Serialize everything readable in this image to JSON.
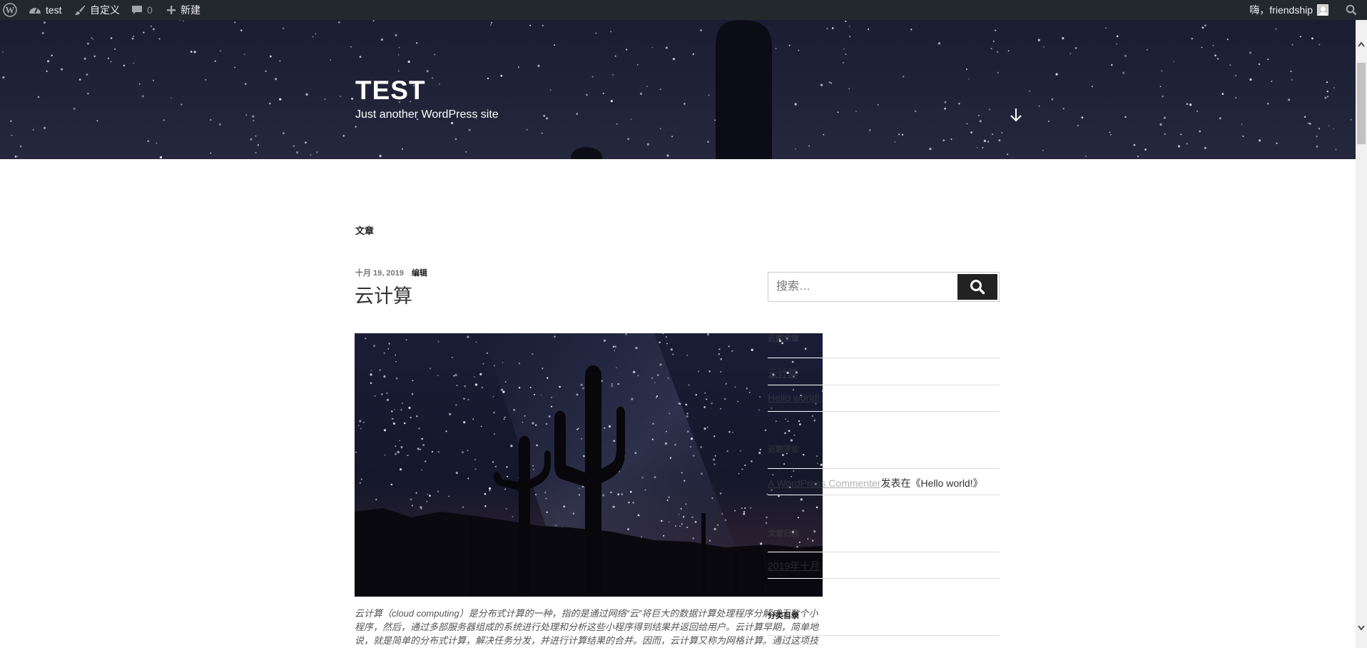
{
  "admin_bar": {
    "site_name": "test",
    "customize_label": "自定义",
    "comments_count": "0",
    "new_label": "新建",
    "howdy_label": "嗨，friendship"
  },
  "header": {
    "site_title": "TEST",
    "site_description": "Just another WordPress site"
  },
  "main": {
    "page_heading": "文章",
    "post": {
      "date": "十月 19, 2019",
      "edit_label": "编辑",
      "title": "云计算",
      "excerpt_lines": [
        "云计算（cloud computing）是分布式计算的一种，指的是通过网络“云”将巨大的数据计算处理程序分解成无数个小",
        "程序，然后，通过多部服务器组成的系统进行处理和分析这些小程序得到结果并返回给用户。云计算早期，简单地",
        "说，就是简单的分布式计算，解决任务分发，并进行计算结果的合并。因而，云计算又称为网格计算。通过这项技"
      ]
    }
  },
  "sidebar": {
    "search_placeholder": "搜索…",
    "recent_posts_title": "近期文章",
    "recent_posts": [
      "云计算",
      "Hello world!"
    ],
    "recent_comments_title": "近期评论",
    "recent_comment": {
      "author": "A WordPress Commenter",
      "middle": "发表在",
      "post": "《Hello world!》"
    },
    "archives_title": "文章归档",
    "archives": [
      "2019年十月"
    ],
    "categories_title": "分类目录"
  }
}
